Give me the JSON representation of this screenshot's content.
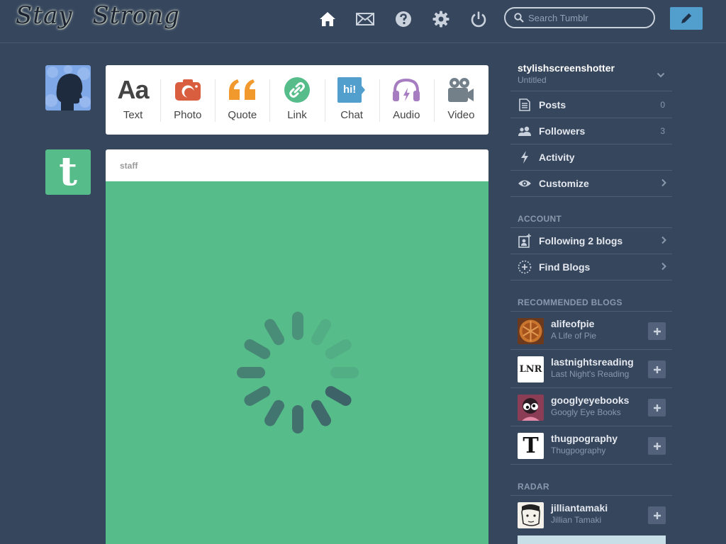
{
  "header": {
    "logo_word1": "Stay",
    "logo_word2": "Strong",
    "search_placeholder": "Search Tumblr",
    "nav_icons": [
      "home-icon",
      "mail-icon",
      "help-icon",
      "gear-icon",
      "power-icon"
    ],
    "compose_icon": "pencil-icon"
  },
  "post_types": [
    {
      "label": "Text",
      "glyph": "Aa",
      "color": "#444444"
    },
    {
      "label": "Photo",
      "color": "#d95e40"
    },
    {
      "label": "Quote",
      "color": "#f2992e"
    },
    {
      "label": "Link",
      "color": "#56bc8a"
    },
    {
      "label": "Chat",
      "glyph": "hi!",
      "color": "#529ecc"
    },
    {
      "label": "Audio",
      "color": "#a77dc2"
    },
    {
      "label": "Video",
      "color": "#748089"
    }
  ],
  "post": {
    "blog": "staff",
    "media_color": "#56bc8a",
    "avatar_letter": "t"
  },
  "sidebar": {
    "blog_name": "stylishscreenshotter",
    "blog_title": "Untitled",
    "items": [
      {
        "label": "Posts",
        "count": "0",
        "icon": "posts-icon"
      },
      {
        "label": "Followers",
        "count": "3",
        "icon": "followers-icon"
      },
      {
        "label": "Activity",
        "icon": "lightning-icon"
      },
      {
        "label": "Customize",
        "icon": "eye-icon"
      }
    ],
    "account_label": "ACCOUNT",
    "account_items": [
      {
        "label": "Following 2 blogs",
        "icon": "following-icon"
      },
      {
        "label": "Find Blogs",
        "icon": "find-blogs-icon"
      }
    ],
    "recommended_label": "RECOMMENDED BLOGS",
    "recommended": [
      {
        "name": "alifeofpie",
        "title": "A Life of Pie"
      },
      {
        "name": "lastnightsreading",
        "title": "Last Night's Reading",
        "avatar_text": "LNR"
      },
      {
        "name": "googlyeyebooks",
        "title": "Googly Eye Books"
      },
      {
        "name": "thugpography",
        "title": "Thugpography",
        "avatar_text": "T"
      }
    ],
    "radar_label": "RADAR",
    "radar": [
      {
        "name": "jilliantamaki",
        "title": "Jillian Tamaki"
      }
    ]
  },
  "colors": {
    "background": "#36465d",
    "accent": "#529ecc",
    "muted": "#8b98ac"
  }
}
